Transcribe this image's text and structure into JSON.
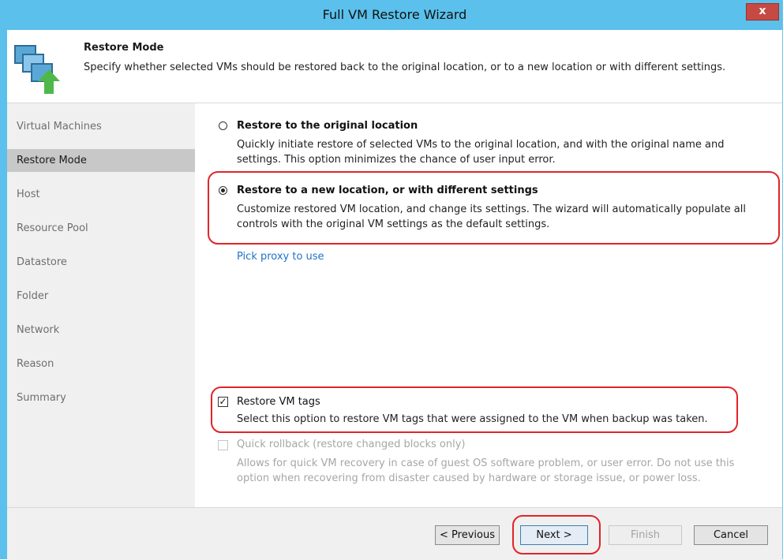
{
  "window": {
    "title": "Full VM Restore Wizard",
    "close_label": "x"
  },
  "header": {
    "title": "Restore Mode",
    "description": "Specify whether selected VMs should be restored back to the original location, or to a new location or with different settings.",
    "icon": "vm-restore-icon"
  },
  "sidebar": {
    "items": [
      {
        "label": "Virtual Machines"
      },
      {
        "label": "Restore Mode"
      },
      {
        "label": "Host"
      },
      {
        "label": "Resource Pool"
      },
      {
        "label": "Datastore"
      },
      {
        "label": "Folder"
      },
      {
        "label": "Network"
      },
      {
        "label": "Reason"
      },
      {
        "label": "Summary"
      }
    ],
    "active": "Restore Mode"
  },
  "options": {
    "original": {
      "title": "Restore to the original location",
      "desc_line1": "Quickly initiate restore of selected VMs to the original location, and with the original name and",
      "desc_line2": "settings. This option minimizes the chance of user input error.",
      "selected": false
    },
    "new_location": {
      "title": "Restore to a new location, or with different settings",
      "desc_line1": "Customize restored VM location, and change its settings. The wizard will automatically populate all",
      "desc_line2": "controls with the original VM settings as the default settings.",
      "selected": true
    },
    "pick_proxy": "Pick proxy to use",
    "restore_tags": {
      "label": "Restore VM tags",
      "desc": "Select this option to restore VM tags that were assigned to the VM when backup was taken.",
      "checked": true,
      "check_glyph": "✓"
    },
    "quick_rollback": {
      "label": "Quick rollback (restore changed blocks only)",
      "desc_line1": "Allows for quick VM recovery in case of guest OS software problem, or user error. Do not use this",
      "desc_line2": "option when recovering from disaster caused by hardware or storage issue, or power loss.",
      "checked": false,
      "enabled": false
    }
  },
  "footer": {
    "previous": "< Previous",
    "next": "Next >",
    "finish": "Finish",
    "cancel": "Cancel"
  },
  "colors": {
    "titlebar": "#5bc0eb",
    "highlight": "#e0242a",
    "link": "#1e73c8",
    "sidebar_active": "#c8c8c8"
  }
}
